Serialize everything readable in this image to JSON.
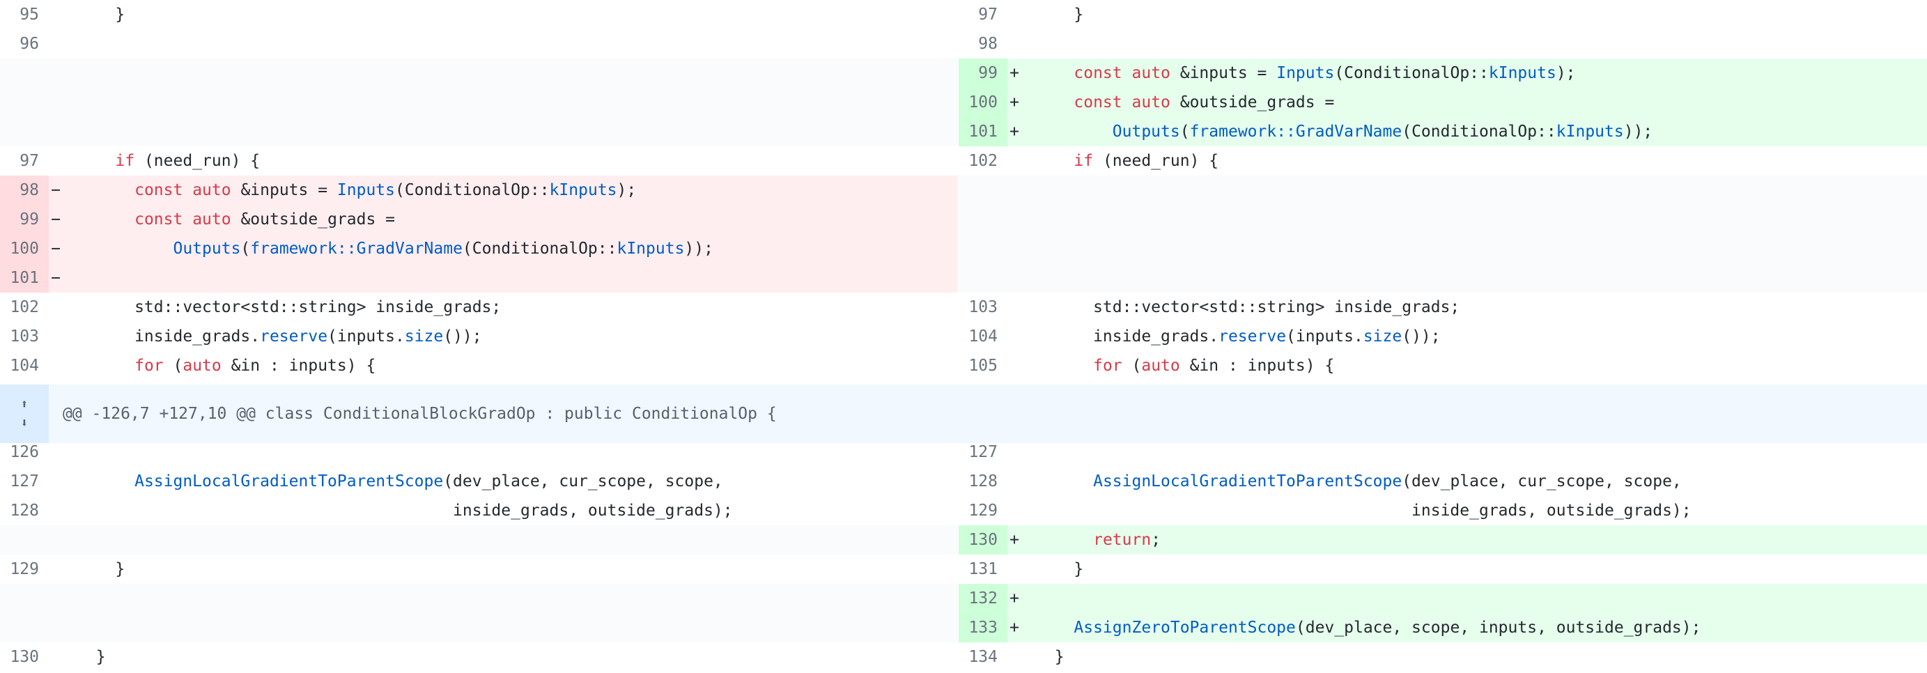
{
  "hunk": {
    "header": "@@ -126,7 +127,10 @@ class ConditionalBlockGradOp : public ConditionalOp {"
  },
  "rows": [
    {
      "type": "ctx",
      "left": {
        "num": "95",
        "tokens": [
          [
            "p",
            "    }"
          ]
        ]
      },
      "right": {
        "num": "97",
        "tokens": [
          [
            "p",
            "    }"
          ]
        ]
      }
    },
    {
      "type": "ctx",
      "left": {
        "num": "96",
        "tokens": []
      },
      "right": {
        "num": "98",
        "tokens": []
      }
    },
    {
      "type": "add",
      "right": {
        "num": "99",
        "sign": "+",
        "tokens": [
          [
            "p",
            "    "
          ],
          [
            "k",
            "const"
          ],
          [
            "p",
            " "
          ],
          [
            "k",
            "auto"
          ],
          [
            "p",
            " &inputs = "
          ],
          [
            "f",
            "Inputs"
          ],
          [
            "p",
            "(ConditionalOp::"
          ],
          [
            "f",
            "kInputs"
          ],
          [
            "p",
            ");"
          ]
        ]
      }
    },
    {
      "type": "add",
      "right": {
        "num": "100",
        "sign": "+",
        "tokens": [
          [
            "p",
            "    "
          ],
          [
            "k",
            "const"
          ],
          [
            "p",
            " "
          ],
          [
            "k",
            "auto"
          ],
          [
            "p",
            " &outside_grads ="
          ]
        ]
      }
    },
    {
      "type": "add",
      "right": {
        "num": "101",
        "sign": "+",
        "tokens": [
          [
            "p",
            "        "
          ],
          [
            "f",
            "Outputs"
          ],
          [
            "p",
            "("
          ],
          [
            "f",
            "framework::GradVarName"
          ],
          [
            "p",
            "(ConditionalOp::"
          ],
          [
            "f",
            "kInputs"
          ],
          [
            "p",
            "));"
          ]
        ]
      }
    },
    {
      "type": "ctx",
      "left": {
        "num": "97",
        "tokens": [
          [
            "p",
            "    "
          ],
          [
            "k",
            "if"
          ],
          [
            "p",
            " (need_run) {"
          ]
        ]
      },
      "right": {
        "num": "102",
        "tokens": [
          [
            "p",
            "    "
          ],
          [
            "k",
            "if"
          ],
          [
            "p",
            " (need_run) {"
          ]
        ]
      }
    },
    {
      "type": "del",
      "left": {
        "num": "98",
        "sign": "−",
        "tokens": [
          [
            "p",
            "      "
          ],
          [
            "k",
            "const"
          ],
          [
            "p",
            " "
          ],
          [
            "k",
            "auto"
          ],
          [
            "p",
            " &inputs = "
          ],
          [
            "f",
            "Inputs"
          ],
          [
            "p",
            "(ConditionalOp::"
          ],
          [
            "f",
            "kInputs"
          ],
          [
            "p",
            ");"
          ]
        ]
      }
    },
    {
      "type": "del",
      "left": {
        "num": "99",
        "sign": "−",
        "tokens": [
          [
            "p",
            "      "
          ],
          [
            "k",
            "const"
          ],
          [
            "p",
            " "
          ],
          [
            "k",
            "auto"
          ],
          [
            "p",
            " &outside_grads ="
          ]
        ]
      }
    },
    {
      "type": "del",
      "left": {
        "num": "100",
        "sign": "−",
        "tokens": [
          [
            "p",
            "          "
          ],
          [
            "f",
            "Outputs"
          ],
          [
            "p",
            "("
          ],
          [
            "f",
            "framework::GradVarName"
          ],
          [
            "p",
            "(ConditionalOp::"
          ],
          [
            "f",
            "kInputs"
          ],
          [
            "p",
            "));"
          ]
        ]
      }
    },
    {
      "type": "del",
      "left": {
        "num": "101",
        "sign": "−",
        "tokens": []
      }
    },
    {
      "type": "ctx",
      "left": {
        "num": "102",
        "tokens": [
          [
            "p",
            "      std::vector<std::string> inside_grads;"
          ]
        ]
      },
      "right": {
        "num": "103",
        "tokens": [
          [
            "p",
            "      std::vector<std::string> inside_grads;"
          ]
        ]
      }
    },
    {
      "type": "ctx",
      "left": {
        "num": "103",
        "tokens": [
          [
            "p",
            "      inside_grads."
          ],
          [
            "f",
            "reserve"
          ],
          [
            "p",
            "(inputs."
          ],
          [
            "f",
            "size"
          ],
          [
            "p",
            "());"
          ]
        ]
      },
      "right": {
        "num": "104",
        "tokens": [
          [
            "p",
            "      inside_grads."
          ],
          [
            "f",
            "reserve"
          ],
          [
            "p",
            "(inputs."
          ],
          [
            "f",
            "size"
          ],
          [
            "p",
            "());"
          ]
        ]
      }
    },
    {
      "type": "ctx",
      "left": {
        "num": "104",
        "tokens": [
          [
            "p",
            "      "
          ],
          [
            "k",
            "for"
          ],
          [
            "p",
            " ("
          ],
          [
            "k",
            "auto"
          ],
          [
            "p",
            " &in : inputs) {"
          ]
        ]
      },
      "right": {
        "num": "105",
        "tokens": [
          [
            "p",
            "      "
          ],
          [
            "k",
            "for"
          ],
          [
            "p",
            " ("
          ],
          [
            "k",
            "auto"
          ],
          [
            "p",
            " &in : inputs) {"
          ]
        ]
      }
    },
    {
      "type": "hunk"
    },
    {
      "type": "ctx",
      "left": {
        "num": "126",
        "tokens": []
      },
      "right": {
        "num": "127",
        "tokens": []
      }
    },
    {
      "type": "ctx",
      "left": {
        "num": "127",
        "tokens": [
          [
            "p",
            "      "
          ],
          [
            "f",
            "AssignLocalGradientToParentScope"
          ],
          [
            "p",
            "(dev_place, cur_scope, scope,"
          ]
        ]
      },
      "right": {
        "num": "128",
        "tokens": [
          [
            "p",
            "      "
          ],
          [
            "f",
            "AssignLocalGradientToParentScope"
          ],
          [
            "p",
            "(dev_place, cur_scope, scope,"
          ]
        ]
      }
    },
    {
      "type": "ctx",
      "left": {
        "num": "128",
        "tokens": [
          [
            "p",
            "                                       inside_grads, outside_grads);"
          ]
        ]
      },
      "right": {
        "num": "129",
        "tokens": [
          [
            "p",
            "                                       inside_grads, outside_grads);"
          ]
        ]
      }
    },
    {
      "type": "add",
      "right": {
        "num": "130",
        "sign": "+",
        "tokens": [
          [
            "p",
            "      "
          ],
          [
            "k",
            "return"
          ],
          [
            "p",
            ";"
          ]
        ]
      }
    },
    {
      "type": "ctx",
      "left": {
        "num": "129",
        "tokens": [
          [
            "p",
            "    }"
          ]
        ]
      },
      "right": {
        "num": "131",
        "tokens": [
          [
            "p",
            "    }"
          ]
        ]
      }
    },
    {
      "type": "add",
      "right": {
        "num": "132",
        "sign": "+",
        "tokens": []
      }
    },
    {
      "type": "add",
      "right": {
        "num": "133",
        "sign": "+",
        "tokens": [
          [
            "p",
            "    "
          ],
          [
            "f",
            "AssignZeroToParentScope"
          ],
          [
            "p",
            "(dev_place, scope, inputs, outside_grads);"
          ]
        ]
      }
    },
    {
      "type": "ctx",
      "left": {
        "num": "130",
        "tokens": [
          [
            "p",
            "  }"
          ]
        ]
      },
      "right": {
        "num": "134",
        "tokens": [
          [
            "p",
            "  }"
          ]
        ]
      }
    }
  ]
}
